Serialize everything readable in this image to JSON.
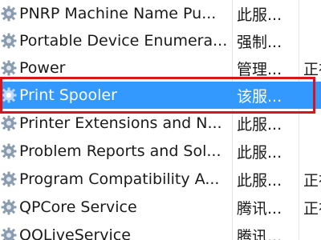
{
  "services": [
    {
      "name": "PNRP Machine Name Pu...",
      "description": "此服...",
      "status": ""
    },
    {
      "name": "Portable Device Enumera...",
      "description": "强制...",
      "status": ""
    },
    {
      "name": "Power",
      "description": "管理...",
      "status": "正在"
    },
    {
      "name": "Print Spooler",
      "description": "该服...",
      "status": ""
    },
    {
      "name": "Printer Extensions and N...",
      "description": "此服...",
      "status": ""
    },
    {
      "name": "Problem Reports and Sol...",
      "description": "此服...",
      "status": ""
    },
    {
      "name": "Program Compatibility A...",
      "description": "此服...",
      "status": "正在"
    },
    {
      "name": "QPCore Service",
      "description": "腾讯...",
      "status": "正在"
    },
    {
      "name": "QQLiveService",
      "description": "腾讯...",
      "status": ""
    }
  ],
  "selected_service": "Print Spooler",
  "icon": "gear-icon",
  "colors": {
    "selection": "#3399ff",
    "annotation_box": "#d6161c"
  }
}
